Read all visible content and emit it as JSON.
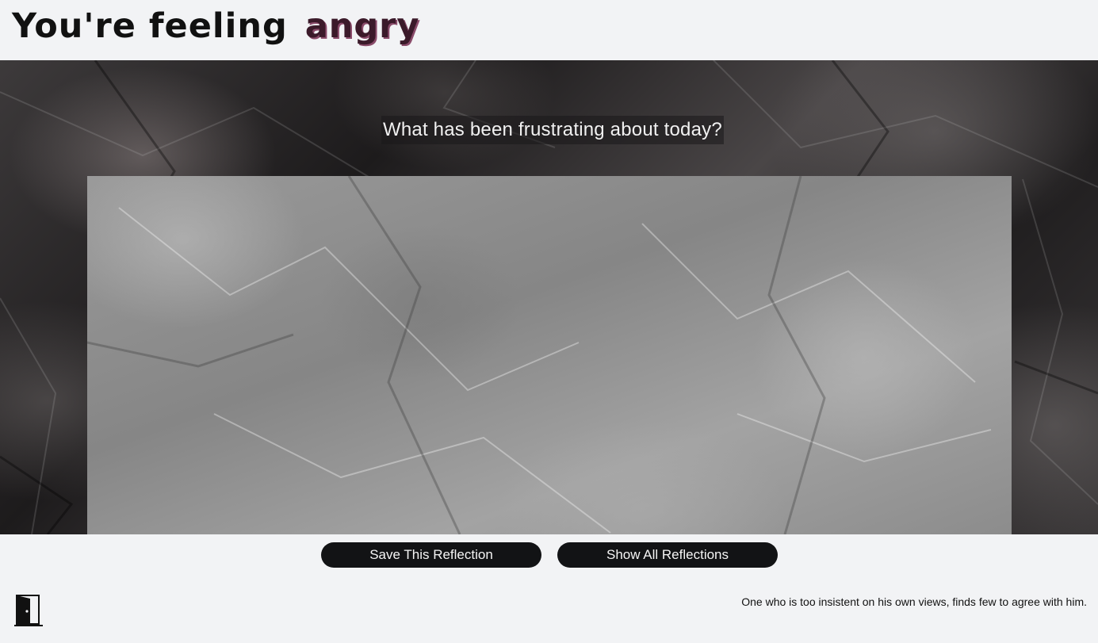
{
  "header": {
    "title_prefix": "You're feeling",
    "emotion": "angry",
    "emotion_color": "#3b1a2a"
  },
  "journal": {
    "prompt": "What has been frustrating about today?",
    "entry_value": "",
    "entry_placeholder": ""
  },
  "actions": {
    "save_label": "Save This Reflection",
    "show_label": "Show All Reflections"
  },
  "footer": {
    "exit_icon": "door-exit-icon",
    "quote": "One who is too insistent on his own views, finds few to agree with him."
  }
}
